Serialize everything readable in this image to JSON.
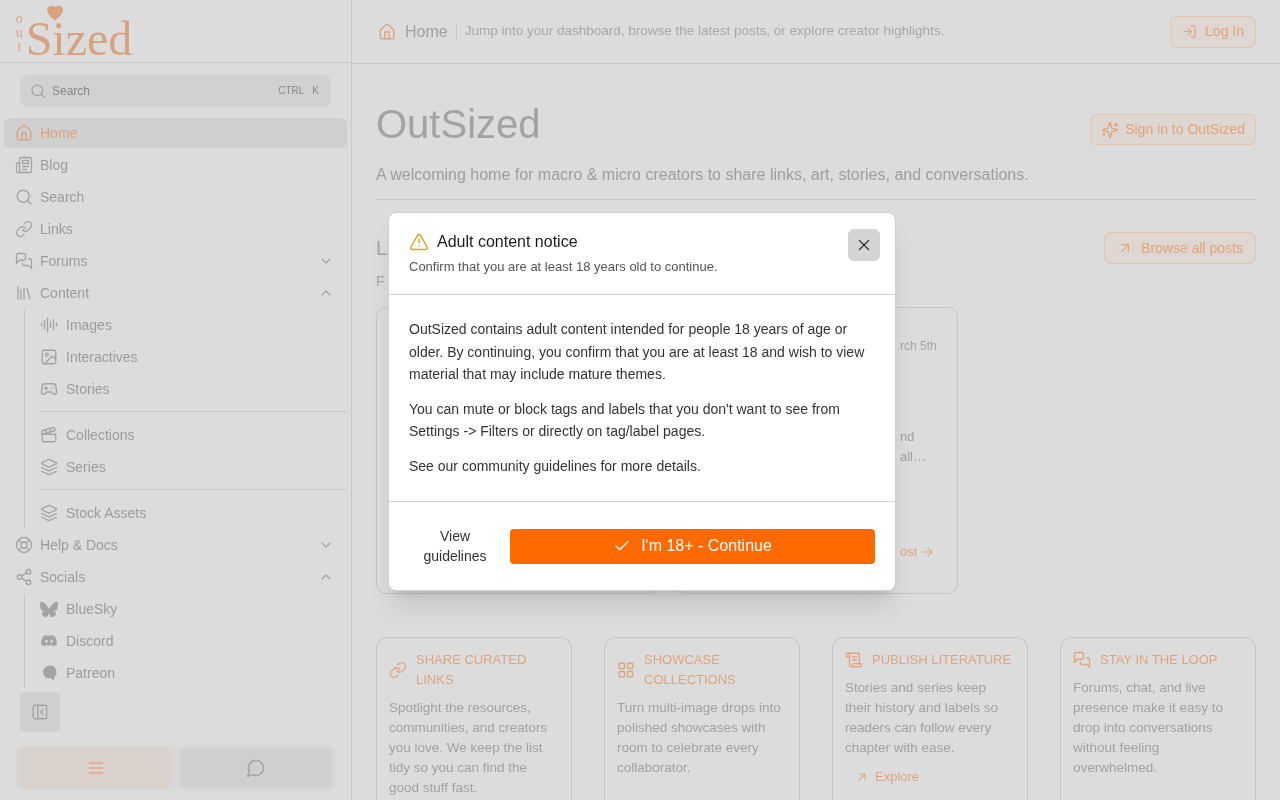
{
  "sidebar": {
    "logo": {
      "prefix": "out",
      "wordmark": "Sized"
    },
    "search": {
      "placeholder": "Search",
      "shortcut": [
        "CTRL",
        "K"
      ]
    },
    "nav": [
      {
        "kind": "link",
        "label": "Home",
        "selected": true
      },
      {
        "kind": "link",
        "label": "Blog",
        "selected": false
      },
      {
        "kind": "link",
        "label": "Search",
        "selected": false
      },
      {
        "kind": "link",
        "label": "Links",
        "selected": false
      },
      {
        "kind": "group",
        "label": "Forums",
        "selected": false,
        "expanded": false
      },
      {
        "kind": "group",
        "label": "Content",
        "selected": false,
        "expanded": true,
        "children": [
          {
            "kind": "link",
            "label": "Images",
            "selected": false
          },
          {
            "kind": "link",
            "label": "Interactives",
            "selected": false
          },
          {
            "kind": "link",
            "label": "Stories",
            "selected": false
          },
          {
            "kind": "divider"
          },
          {
            "kind": "link",
            "label": "Collections",
            "selected": false
          },
          {
            "kind": "link",
            "label": "Series",
            "selected": false
          },
          {
            "kind": "divider"
          },
          {
            "kind": "link",
            "label": "Stock Assets",
            "selected": false
          }
        ]
      },
      {
        "kind": "group",
        "label": "Help & Docs",
        "selected": false,
        "expanded": false
      },
      {
        "kind": "group",
        "label": "Socials",
        "selected": false,
        "expanded": true,
        "children": [
          {
            "kind": "link",
            "label": "BlueSky",
            "selected": false
          },
          {
            "kind": "link",
            "label": "Discord",
            "selected": false
          },
          {
            "kind": "link",
            "label": "Patreon",
            "selected": false
          }
        ]
      }
    ],
    "bottom_tabs": [
      {
        "selected": true
      },
      {
        "selected": false
      }
    ]
  },
  "header": {
    "title": "Home",
    "description": "Jump into your dashboard, browse the latest posts, or explore creator highlights.",
    "login_button": "Log In"
  },
  "hero": {
    "title": "OutSized",
    "signin_button": "Sign in to OutSized",
    "subtitle": "A welcoming home for macro & micro creators to share links, art, stories, and conversations."
  },
  "latest": {
    "heading": "L",
    "subheading": "F",
    "browse_button": "Browse all posts",
    "posts": [
      {
        "date": "rch 5th",
        "excerpt": [
          "nd",
          "all…"
        ],
        "link": "ost"
      }
    ]
  },
  "features": [
    {
      "title": "SHARE CURATED LINKS",
      "text": "Spotlight the resources, communities, and creators you love. We keep the list tidy so you can find the good stuff fast."
    },
    {
      "title": "SHOWCASE COLLECTIONS",
      "text": "Turn multi-image drops into polished showcases with room to celebrate every collaborator."
    },
    {
      "title": "PUBLISH LITERATURE",
      "text": "Stories and series keep their history and labels so readers can follow every chapter with ease.",
      "link": "Explore"
    },
    {
      "title": "STAY IN THE LOOP",
      "text": "Forums, chat, and live presence make it easy to drop into conversations without feeling overwhelmed."
    }
  ],
  "modal": {
    "title": "Adult content notice",
    "subtitle": "Confirm that you are at least 18 years old to continue.",
    "paragraphs": [
      "OutSized contains adult content intended for people 18 years of age or older. By continuing, you confirm that you are at least 18 and wish to view material that may include mature themes.",
      "You can mute or block tags and labels that you don't want to see from Settings -> Filters or directly on tag/label pages.",
      "See our community guidelines for more details."
    ],
    "secondary_button": "View guidelines",
    "primary_button": "I'm 18+ - Continue"
  }
}
